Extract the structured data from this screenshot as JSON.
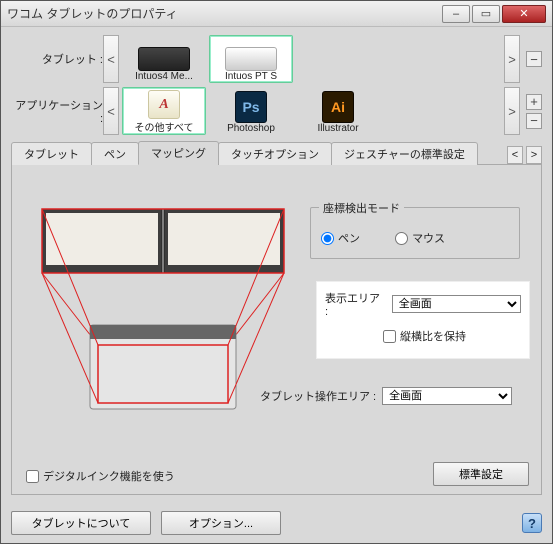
{
  "window": {
    "title": "ワコム タブレットのプロパティ"
  },
  "rows": {
    "tablet_label": "タブレット :",
    "app_label": "アプリケーション :",
    "tablets": [
      {
        "name": "Intuos4 Me...",
        "selected": false
      },
      {
        "name": "Intuos PT S",
        "selected": true
      }
    ],
    "apps": [
      {
        "name": "その他すべて",
        "icon": "all",
        "selected": true
      },
      {
        "name": "Photoshop",
        "icon": "ps",
        "selected": false
      },
      {
        "name": "Illustrator",
        "icon": "ai",
        "selected": false
      }
    ],
    "icon_text": {
      "all": "A",
      "ps": "Ps",
      "ai": "Ai"
    }
  },
  "tabs": {
    "items": [
      {
        "label": "タブレット"
      },
      {
        "label": "ペン"
      },
      {
        "label": "マッピング"
      },
      {
        "label": "タッチオプション"
      },
      {
        "label": "ジェスチャーの標準設定"
      }
    ],
    "selected_index": 2
  },
  "mapping": {
    "mode_group_label": "座標検出モード",
    "mode_pen": "ペン",
    "mode_mouse": "マウス",
    "mode_selected": "pen",
    "display_area_label": "表示エリア :",
    "display_area_value": "全画面",
    "keep_aspect_label": "縦横比を保持",
    "keep_aspect_checked": false,
    "tablet_area_label": "タブレット操作エリア :",
    "tablet_area_value": "全画面",
    "digital_ink_label": "デジタルインク機能を使う",
    "digital_ink_checked": false,
    "default_btn": "標準設定"
  },
  "footer": {
    "about": "タブレットについて",
    "options": "オプション..."
  },
  "icons": {
    "prev": "<",
    "next": ">",
    "minus": "−",
    "plus": "+",
    "help": "?"
  },
  "winbuttons": {
    "min": "–",
    "max": "▭",
    "close": "✕"
  }
}
